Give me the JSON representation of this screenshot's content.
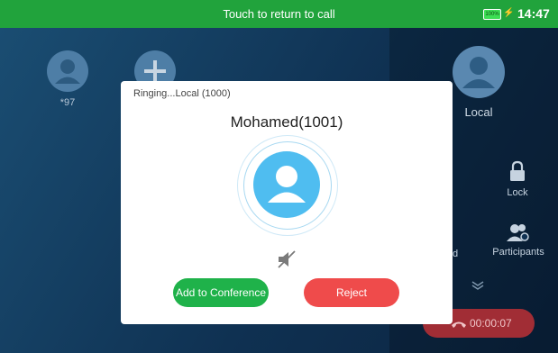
{
  "status_bar": {
    "banner": "Touch to return to call",
    "battery": "100%",
    "time": "14:47"
  },
  "background": {
    "contacts": [
      {
        "label": "*97",
        "icon": "person-icon"
      },
      {
        "label": "",
        "icon": "plus-icon"
      }
    ],
    "local": {
      "label": "Local",
      "icon": "person-icon"
    },
    "side_actions": [
      {
        "label": "Lock",
        "icon": "lock-icon"
      },
      {
        "label": "Participants",
        "icon": "participants-icon"
      }
    ],
    "partial_label": "d",
    "end_call": {
      "timer": "00:00:07",
      "icon": "phone-hangup-icon"
    }
  },
  "dialog": {
    "status": "Ringing...Local (1000)",
    "caller": "Mohamed(1001)",
    "add_conference": "Add to Conference",
    "reject": "Reject"
  },
  "colors": {
    "status_bar": "#21a33c",
    "add_conference": "#1fb24a",
    "reject": "#ef4b4b",
    "end_call": "#a12d35",
    "caller_avatar": "#4fbdf0"
  }
}
